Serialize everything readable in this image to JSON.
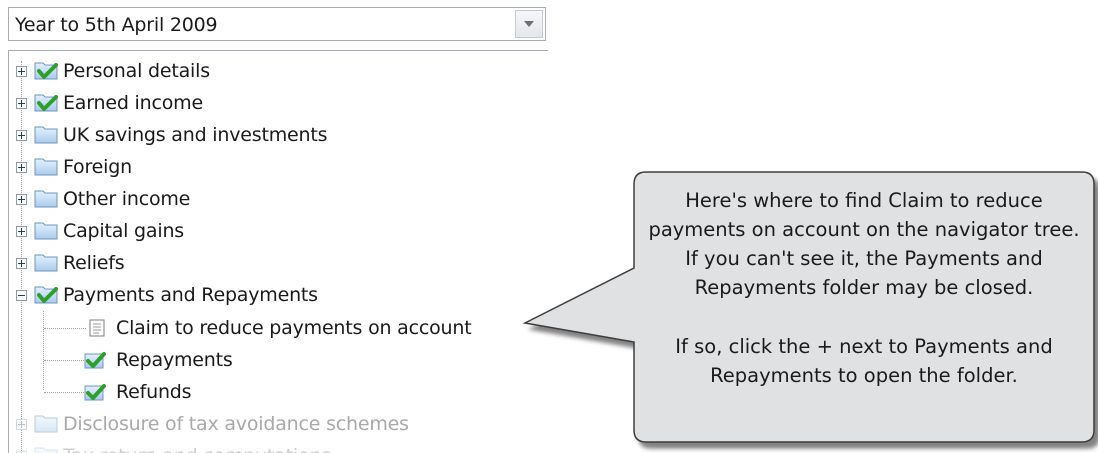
{
  "year_select": {
    "value": "Year to 5th April 2009"
  },
  "tree": {
    "items": [
      {
        "label": "Personal details"
      },
      {
        "label": "Earned income"
      },
      {
        "label": "UK savings and investments"
      },
      {
        "label": "Foreign"
      },
      {
        "label": "Other income"
      },
      {
        "label": "Capital gains"
      },
      {
        "label": "Reliefs"
      },
      {
        "label": "Payments and Repayments"
      },
      {
        "label": "Claim to reduce payments on account"
      },
      {
        "label": "Repayments"
      },
      {
        "label": "Refunds"
      },
      {
        "label": "Disclosure of tax avoidance schemes"
      },
      {
        "label": "Tax return and computations"
      }
    ]
  },
  "callout": {
    "paragraph1": "Here's where to find Claim to reduce payments on account on the navigator tree. If you can't see it, the Payments and Repayments folder may be closed.",
    "paragraph2": "If so, click the + next to Payments and Repayments to open the folder."
  },
  "colors": {
    "callout_bg": "#dfe0e2",
    "check_green": "#3aa43a",
    "folder_blue": "#b9d6f2"
  }
}
